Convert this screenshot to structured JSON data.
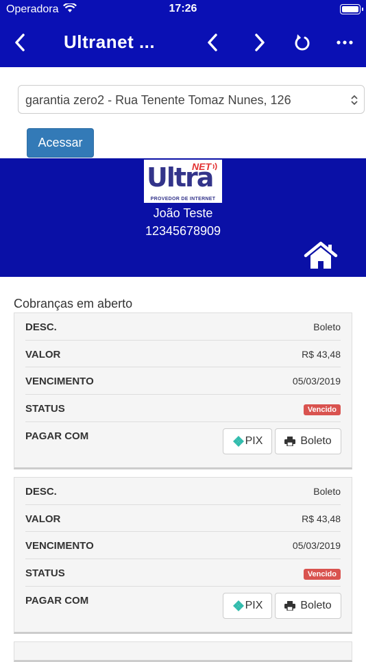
{
  "statusbar": {
    "carrier": "Operadora",
    "time": "17:26"
  },
  "nav": {
    "title": "Ultranet ..."
  },
  "selector": {
    "value": "garantia zero2 - Rua Tenente Tomaz Nunes, 126"
  },
  "access_button": "Acessar",
  "profile": {
    "logo_main": "Ultra",
    "logo_net": "NET",
    "logo_tagline": "PROVEDOR DE INTERNET",
    "name": "João Teste",
    "document": "12345678909"
  },
  "section_title": "Cobranças em aberto",
  "labels": {
    "desc": "DESC.",
    "valor": "VALOR",
    "vencimento": "VENCIMENTO",
    "status": "STATUS",
    "pagar": "PAGAR COM"
  },
  "pay_buttons": {
    "pix": "PIX",
    "boleto": "Boleto"
  },
  "charges": [
    {
      "desc": "Boleto",
      "valor": "R$ 43,48",
      "vencimento": "05/03/2019",
      "status": "Vencido"
    },
    {
      "desc": "Boleto",
      "valor": "R$ 43,48",
      "vencimento": "05/03/2019",
      "status": "Vencido"
    }
  ],
  "colors": {
    "primary": "#0a10b4",
    "button": "#337ab7",
    "danger": "#d9534f",
    "pix": "#32bcad"
  }
}
